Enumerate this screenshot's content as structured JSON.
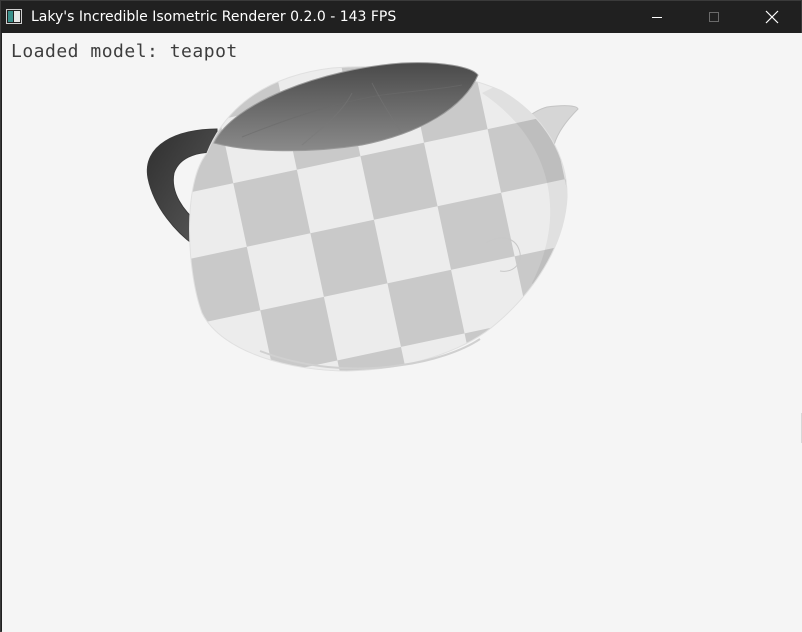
{
  "window": {
    "title": "Laky's Incredible Isometric Renderer 0.2.0 - 143 FPS",
    "app_icon": "app-window-icon",
    "controls": {
      "minimize_icon": "minimize-icon",
      "maximize_icon": "maximize-icon",
      "close_icon": "close-icon"
    },
    "colors": {
      "titlebar": "#202020",
      "title_text": "#ffffff",
      "viewport_background": "#f5f5f5"
    }
  },
  "viewport": {
    "status_text": "Loaded model: teapot",
    "model_render": {
      "model": "teapot",
      "texture": "checkerboard",
      "colors": {
        "light_tile": "#ececec",
        "dark_tile": "#c8c8c8",
        "interior": "#5a5a5a",
        "handle": "#444444"
      }
    }
  }
}
